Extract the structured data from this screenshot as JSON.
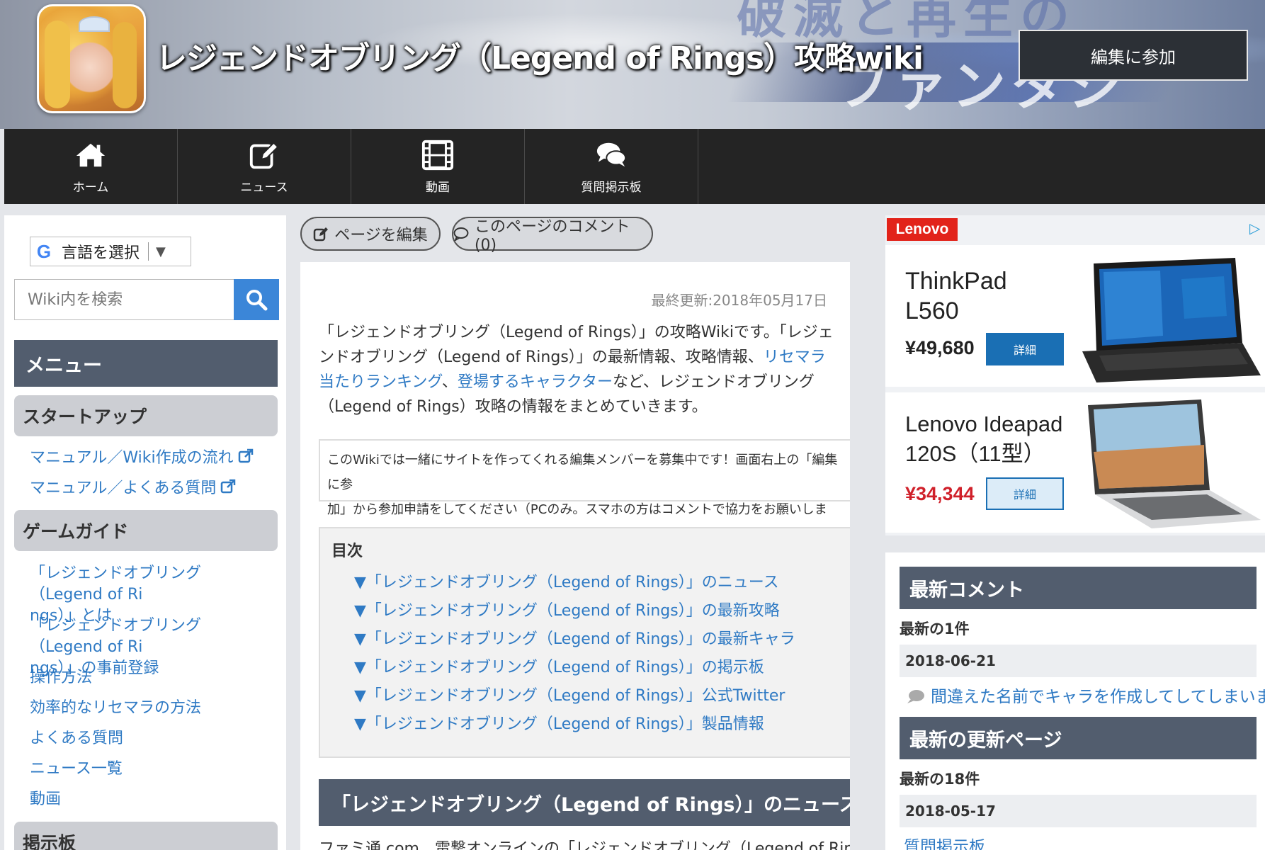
{
  "header": {
    "site_title": "レジェンドオブリング（Legend of Rings）攻略wiki",
    "join_button": "編集に参加",
    "banner_bg_text": "ファンタジ",
    "banner_bg_top_text": "破滅と再生の"
  },
  "nav": {
    "items": [
      {
        "label": "ホーム",
        "icon": "home-icon"
      },
      {
        "label": "ニュース",
        "icon": "edit-icon"
      },
      {
        "label": "動画",
        "icon": "film-icon"
      },
      {
        "label": "質問掲示板",
        "icon": "comments-icon"
      }
    ]
  },
  "sidebar": {
    "translate_label": "言語を選択",
    "translate_arrow": "▼",
    "search_placeholder": "Wiki内を検索",
    "menu_title": "メニュー",
    "categories": [
      {
        "title": "スタートアップ",
        "links": [
          "マニュアル／Wiki作成の流れ",
          "マニュアル／よくある質問"
        ]
      },
      {
        "title": "ゲームガイド",
        "links": [
          "「レジェンドオブリング（Legend of Ri",
          "ngs）」とは",
          "「レジェンドオブリング（Legend of Ri",
          "ngs）」の事前登録",
          "操作方法",
          "効率的なリセマラの方法",
          "よくある質問",
          "ニュース一覧",
          "動画"
        ]
      },
      {
        "title": "掲示板",
        "links": []
      }
    ]
  },
  "center": {
    "edit_page_button": "ページを編集",
    "comments_button": "このページのコメント(0)",
    "last_updated": "最終更新:2018年05月17日",
    "intro": {
      "p1": "「レジェンドオブリング（Legend of Rings）」の攻略Wikiです。「レジェンドオブリン",
      "p2": "グ（Legend of Rings）」の最新情報、攻略情報、",
      "link1": "リセマラ当たりランキング",
      "p3": "、",
      "link2a": "登",
      "link2b": "場するキャラクター",
      "p4": "など、レジェンドオブリング（Legend of Rings）攻略の情報をま",
      "p5": "とめていきます。"
    },
    "notice": {
      "line1": "このWikiでは一緒にサイトを作ってくれる編集メンバーを募集中です！画面右上の「編集に参",
      "line2": "加」から参加申請をしてください（PCのみ。スマホの方はコメントで協力をお願いします！）。"
    },
    "toc": {
      "title": "目次",
      "items": [
        "▼「レジェンドオブリング（Legend of Rings）」のニュース",
        "▼「レジェンドオブリング（Legend of Rings）」の最新攻略",
        "▼「レジェンドオブリング（Legend of Rings）」の最新キャラ",
        "▼「レジェンドオブリング（Legend of Rings）」の掲示板",
        "▼「レジェンドオブリング（Legend of Rings）」公式Twitter",
        "▼「レジェンドオブリング（Legend of Rings）」製品情報"
      ]
    },
    "section_title": "「レジェンドオブリング（Legend of Rings）」のニュース",
    "section_dagger": "†",
    "section_body": "ファミ通.com、電撃オンラインの「レジェンドオブリング（Legend of Rings）」に関"
  },
  "ad": {
    "brand": "Lenovo",
    "choices": "▷",
    "products": [
      {
        "name_line1": "ThinkPad",
        "name_line2": "L560",
        "price": "¥49,680",
        "button": "詳細"
      },
      {
        "name_line1": "Lenovo Ideapad",
        "name_line2": "120S（11型）",
        "price": "¥34,344",
        "button": "詳細"
      }
    ],
    "colors": {
      "brand_red": "#e2231a",
      "button_blue": "#1a6fb4",
      "sale_red": "#d0202a"
    }
  },
  "right_panel": {
    "latest_comments_title": "最新コメント",
    "latest_comments_count": "最新の1件",
    "comment_date": "2018-06-21",
    "comment_text": "間違えた名前でキャラを作成してしてしまいま…",
    "latest_pages_title": "最新の更新ページ",
    "latest_pages_count": "最新の18件",
    "page_date": "2018-05-17",
    "page_link": "質問掲示板"
  }
}
